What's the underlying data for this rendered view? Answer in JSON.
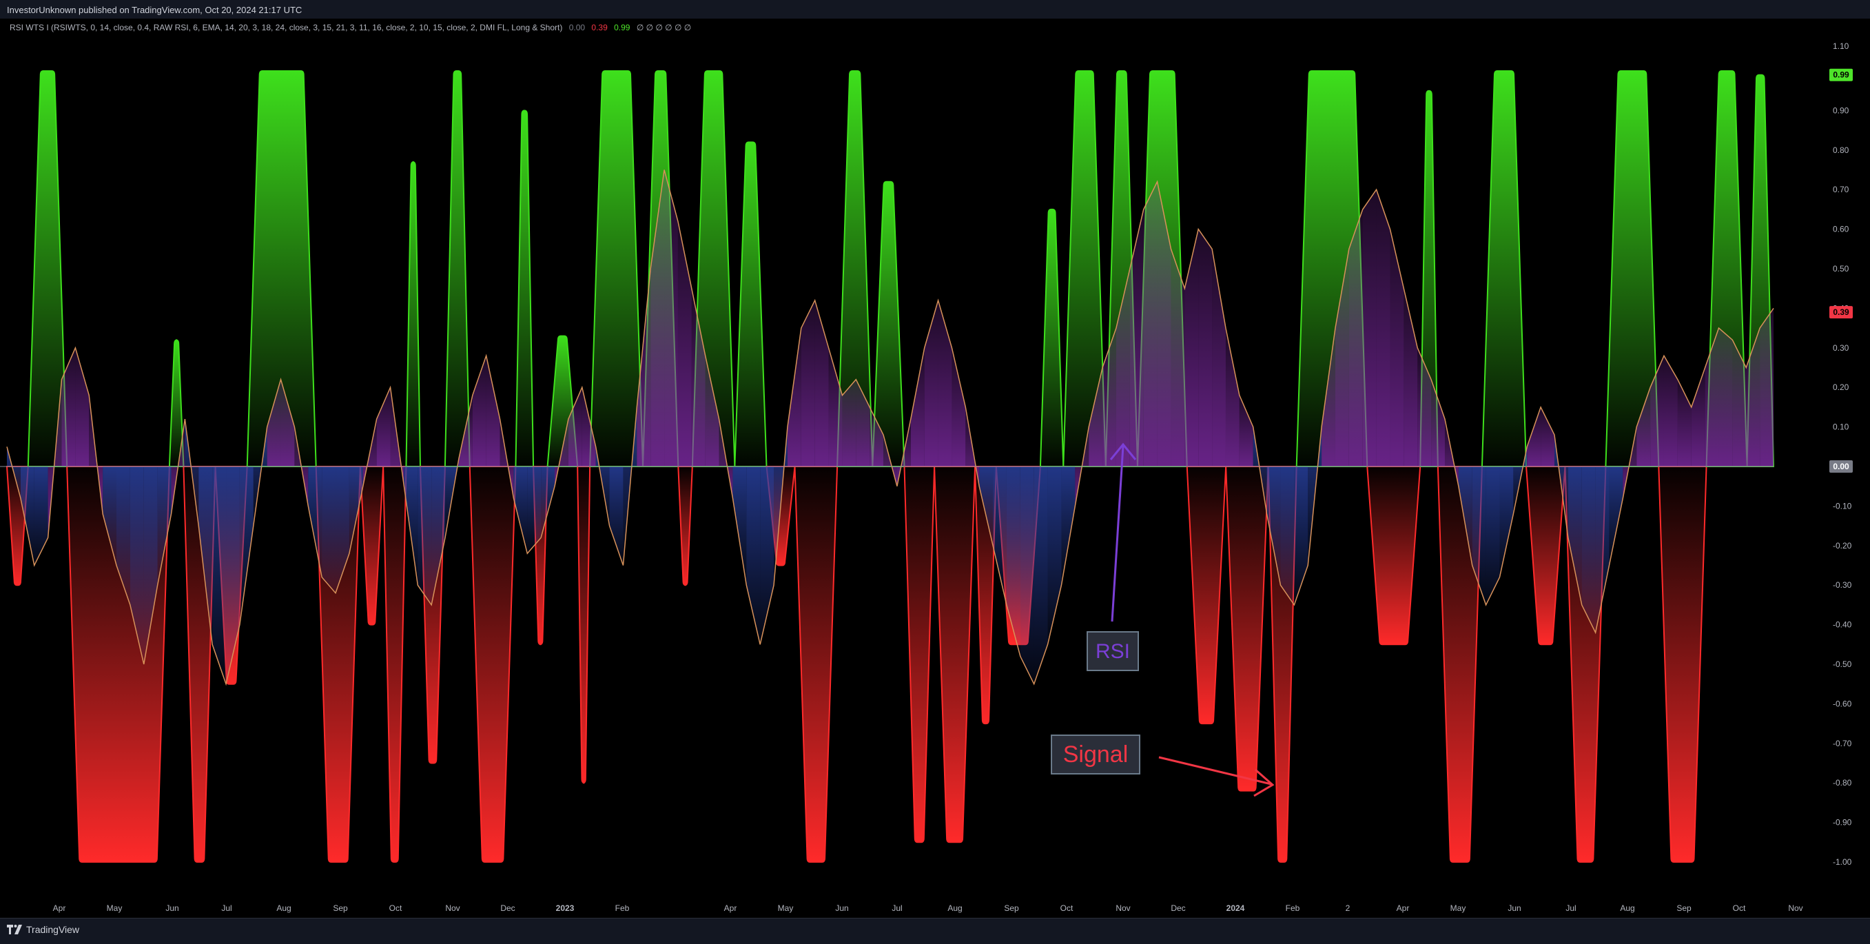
{
  "header": {
    "attribution": "InvestorUnknown published on TradingView.com, Oct 20, 2024 21:17 UTC"
  },
  "indicator": {
    "legend": "RSI WTS I (RSIWTS, 0, 14, close, 0.4, RAW RSI, 6, EMA, 14, 20, 3, 18, 24, close, 3, 15, 21, 3, 11, 16, close, 2, 10, 15, close, 2, DMI FL, Long & Short)",
    "value_1": "0.00",
    "value_2": "0.39",
    "value_3": "0.99",
    "placeholders": "∅ ∅ ∅ ∅ ∅ ∅",
    "value_colors": [
      "#787b86",
      "#f23645",
      "#4ee42a"
    ]
  },
  "footer": {
    "brand": "TradingView"
  },
  "annotations": {
    "rsi_label": "RSI",
    "signal_label": "Signal"
  },
  "colors": {
    "background": "#000000",
    "signal_positive": "#3ee01c",
    "signal_negative": "#ff2a2a",
    "rsi_fill_positive": "#8a2fb4",
    "rsi_fill_negative": "#2a44a8",
    "rsi_line": "#d8925a",
    "zero_line": "#8a8f99",
    "rsi_label_text": "#7b3fd6",
    "signal_label_text": "#f23645",
    "label_box_fill": "#2a2e39",
    "label_box_border": "#6a7a8a"
  },
  "chart_data": {
    "type": "area",
    "title": "",
    "ylim": [
      -1.1,
      1.1
    ],
    "y_ticks": [
      "1.10",
      "0.90",
      "0.80",
      "0.70",
      "0.60",
      "0.50",
      "0.40",
      "0.30",
      "0.20",
      "0.10",
      "0.00",
      "-0.10",
      "-0.20",
      "-0.30",
      "-0.40",
      "-0.50",
      "-0.60",
      "-0.70",
      "-0.80",
      "-0.90",
      "-1.00"
    ],
    "x_ticks": [
      "Apr",
      "May",
      "Jun",
      "Jul",
      "Aug",
      "Sep",
      "Oct",
      "Nov",
      "Dec",
      "2023",
      "Feb",
      "Apr",
      "May",
      "Jun",
      "Jul",
      "Aug",
      "Sep",
      "Oct",
      "Nov",
      "Dec",
      "2024",
      "Feb",
      "2",
      "Apr",
      "May",
      "Jun",
      "Jul",
      "Aug",
      "Sep",
      "Oct",
      "Nov"
    ],
    "price_badges": [
      {
        "label": "0.99",
        "value": 0.99,
        "color": "#4ee42a"
      },
      {
        "label": "0.39",
        "value": 0.39,
        "color": "#f23645"
      },
      {
        "label": "0.00",
        "value": 0.0,
        "color": "#787b86"
      }
    ],
    "series": [
      {
        "name": "Signal",
        "segments": [
          {
            "start": 0.0,
            "end": 0.012,
            "value": -0.3
          },
          {
            "start": 0.012,
            "end": 0.034,
            "value": 1.0
          },
          {
            "start": 0.034,
            "end": 0.092,
            "value": -1.0
          },
          {
            "start": 0.092,
            "end": 0.1,
            "value": 0.32
          },
          {
            "start": 0.1,
            "end": 0.118,
            "value": -1.0
          },
          {
            "start": 0.118,
            "end": 0.136,
            "value": -0.55
          },
          {
            "start": 0.136,
            "end": 0.175,
            "value": 1.0
          },
          {
            "start": 0.175,
            "end": 0.2,
            "value": -1.0
          },
          {
            "start": 0.2,
            "end": 0.213,
            "value": -0.4
          },
          {
            "start": 0.213,
            "end": 0.226,
            "value": -1.0
          },
          {
            "start": 0.226,
            "end": 0.234,
            "value": 0.77
          },
          {
            "start": 0.234,
            "end": 0.248,
            "value": -0.75
          },
          {
            "start": 0.248,
            "end": 0.262,
            "value": 1.0
          },
          {
            "start": 0.262,
            "end": 0.288,
            "value": -1.0
          },
          {
            "start": 0.288,
            "end": 0.298,
            "value": 0.9
          },
          {
            "start": 0.298,
            "end": 0.306,
            "value": -0.45
          },
          {
            "start": 0.306,
            "end": 0.323,
            "value": 0.33
          },
          {
            "start": 0.323,
            "end": 0.33,
            "value": -0.8
          },
          {
            "start": 0.33,
            "end": 0.36,
            "value": 1.0
          },
          {
            "start": 0.36,
            "end": 0.38,
            "value": 1.0
          },
          {
            "start": 0.38,
            "end": 0.388,
            "value": -0.3
          },
          {
            "start": 0.388,
            "end": 0.412,
            "value": 1.0
          },
          {
            "start": 0.412,
            "end": 0.43,
            "value": 0.82
          },
          {
            "start": 0.43,
            "end": 0.446,
            "value": -0.25
          },
          {
            "start": 0.446,
            "end": 0.47,
            "value": -1.0
          },
          {
            "start": 0.47,
            "end": 0.49,
            "value": 1.0
          },
          {
            "start": 0.49,
            "end": 0.508,
            "value": 0.72
          },
          {
            "start": 0.508,
            "end": 0.525,
            "value": -0.95
          },
          {
            "start": 0.525,
            "end": 0.548,
            "value": -0.95
          },
          {
            "start": 0.548,
            "end": 0.56,
            "value": -0.65
          },
          {
            "start": 0.56,
            "end": 0.585,
            "value": -0.45
          },
          {
            "start": 0.585,
            "end": 0.598,
            "value": 0.65
          },
          {
            "start": 0.598,
            "end": 0.622,
            "value": 1.0
          },
          {
            "start": 0.622,
            "end": 0.64,
            "value": 1.0
          },
          {
            "start": 0.64,
            "end": 0.668,
            "value": 1.0
          },
          {
            "start": 0.668,
            "end": 0.69,
            "value": -0.65
          },
          {
            "start": 0.69,
            "end": 0.714,
            "value": -0.82
          },
          {
            "start": 0.714,
            "end": 0.73,
            "value": -1.0
          },
          {
            "start": 0.73,
            "end": 0.77,
            "value": 1.0
          },
          {
            "start": 0.77,
            "end": 0.8,
            "value": -0.45
          },
          {
            "start": 0.8,
            "end": 0.81,
            "value": 0.95
          },
          {
            "start": 0.81,
            "end": 0.835,
            "value": -1.0
          },
          {
            "start": 0.835,
            "end": 0.86,
            "value": 1.0
          },
          {
            "start": 0.86,
            "end": 0.882,
            "value": -0.45
          },
          {
            "start": 0.882,
            "end": 0.905,
            "value": -1.0
          },
          {
            "start": 0.905,
            "end": 0.935,
            "value": 1.0
          },
          {
            "start": 0.935,
            "end": 0.962,
            "value": -1.0
          },
          {
            "start": 0.962,
            "end": 0.985,
            "value": 1.0
          },
          {
            "start": 0.985,
            "end": 1.0,
            "value": 0.99
          }
        ]
      },
      {
        "name": "RSI",
        "values": [
          0.05,
          -0.08,
          -0.25,
          -0.18,
          0.22,
          0.3,
          0.18,
          -0.12,
          -0.25,
          -0.35,
          -0.5,
          -0.3,
          -0.12,
          0.12,
          -0.15,
          -0.45,
          -0.55,
          -0.4,
          -0.15,
          0.1,
          0.22,
          0.1,
          -0.1,
          -0.28,
          -0.32,
          -0.22,
          -0.05,
          0.12,
          0.2,
          -0.05,
          -0.3,
          -0.35,
          -0.18,
          0.02,
          0.18,
          0.28,
          0.12,
          -0.08,
          -0.22,
          -0.18,
          -0.05,
          0.12,
          0.2,
          0.05,
          -0.15,
          -0.25,
          0.15,
          0.5,
          0.75,
          0.62,
          0.45,
          0.28,
          0.12,
          -0.08,
          -0.3,
          -0.45,
          -0.3,
          0.1,
          0.35,
          0.42,
          0.3,
          0.18,
          0.22,
          0.15,
          0.08,
          -0.05,
          0.12,
          0.3,
          0.42,
          0.3,
          0.15,
          -0.05,
          -0.2,
          -0.35,
          -0.48,
          -0.55,
          -0.45,
          -0.3,
          -0.1,
          0.1,
          0.25,
          0.35,
          0.5,
          0.65,
          0.72,
          0.55,
          0.45,
          0.6,
          0.55,
          0.35,
          0.18,
          0.1,
          -0.12,
          -0.3,
          -0.35,
          -0.25,
          0.1,
          0.35,
          0.55,
          0.65,
          0.7,
          0.6,
          0.45,
          0.3,
          0.22,
          0.12,
          -0.05,
          -0.25,
          -0.35,
          -0.28,
          -0.12,
          0.05,
          0.15,
          0.08,
          -0.18,
          -0.35,
          -0.42,
          -0.25,
          -0.08,
          0.1,
          0.2,
          0.28,
          0.22,
          0.15,
          0.25,
          0.35,
          0.32,
          0.25,
          0.35,
          0.4
        ]
      }
    ]
  }
}
